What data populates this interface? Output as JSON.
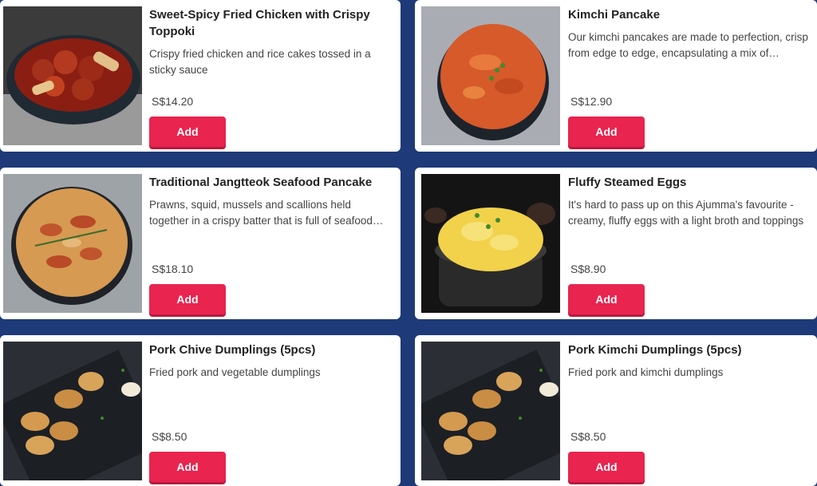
{
  "colors": {
    "background": "#1e3a78",
    "card": "#ffffff",
    "accent": "#e8244f"
  },
  "items": [
    {
      "title": "Sweet-Spicy Fried Chicken with Crispy Toppoki",
      "description": "Crispy fried chicken and rice cakes tossed in a sticky sauce",
      "price": "S$14.20",
      "add_label": "Add",
      "image": "fried-chicken-image"
    },
    {
      "title": "Kimchi Pancake",
      "description": "Our kimchi pancakes are made to perfection, crisp from edge to edge, encapsulating a mix of flavours",
      "price": "S$12.90",
      "add_label": "Add",
      "image": "kimchi-pancake-image"
    },
    {
      "title": "Traditional Jangtteok Seafood Pancake",
      "description": "Prawns, squid, mussels and scallions held together in a crispy batter that is full of seafood flavour",
      "price": "S$18.10",
      "add_label": "Add",
      "image": "seafood-pancake-image"
    },
    {
      "title": "Fluffy Steamed Eggs",
      "description": "It's hard to pass up on this Ajumma's favourite - creamy, fluffy eggs with a light broth and toppings",
      "price": "S$8.90",
      "add_label": "Add",
      "image": "steamed-eggs-image"
    },
    {
      "title": "Pork Chive Dumplings (5pcs)",
      "description": "Fried pork and vegetable dumplings",
      "price": "S$8.50",
      "add_label": "Add",
      "image": "chive-dumplings-image"
    },
    {
      "title": "Pork Kimchi Dumplings (5pcs)",
      "description": "Fried pork and kimchi dumplings",
      "price": "S$8.50",
      "add_label": "Add",
      "image": "kimchi-dumplings-image"
    }
  ]
}
